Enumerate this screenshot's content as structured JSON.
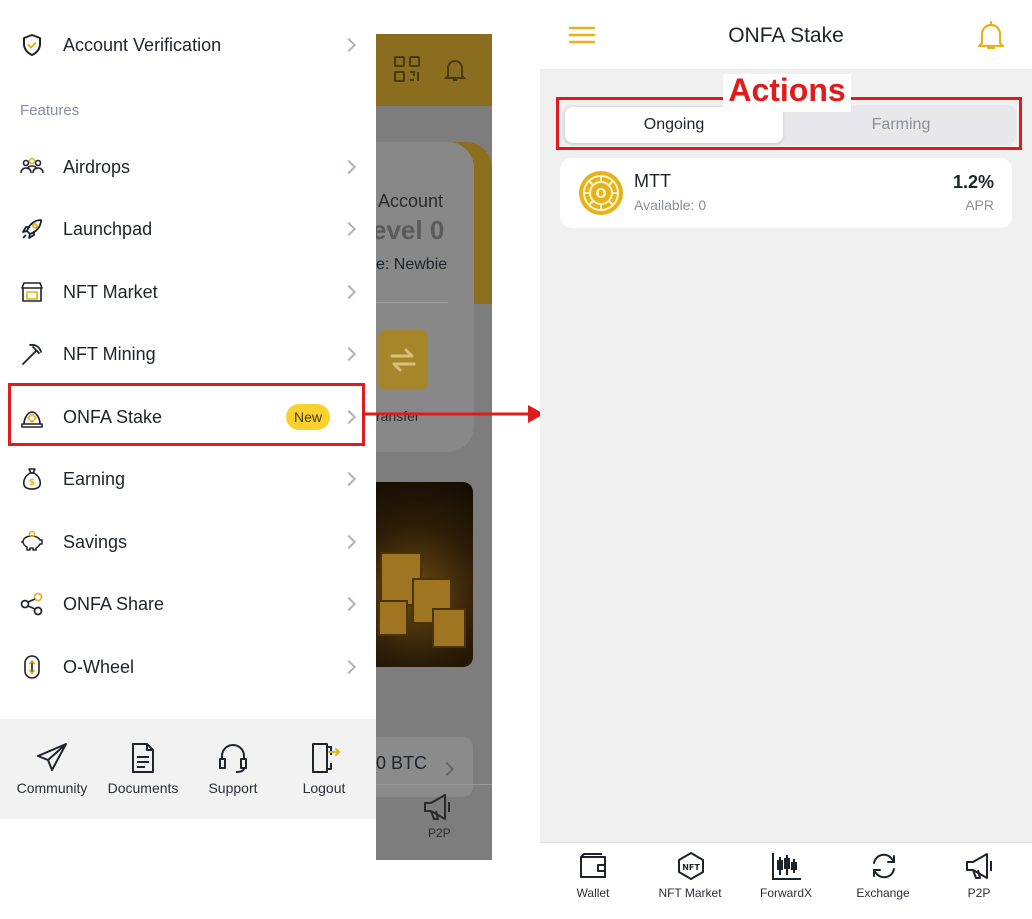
{
  "drawer": {
    "account_verification": "Account Verification",
    "features_label": "Features",
    "items": [
      {
        "label": "Airdrops",
        "icon": "airdrops-icon"
      },
      {
        "label": "Launchpad",
        "icon": "rocket-icon"
      },
      {
        "label": "NFT Market",
        "icon": "nft-market-icon"
      },
      {
        "label": "NFT Mining",
        "icon": "pickaxe-icon"
      },
      {
        "label": "ONFA Stake",
        "icon": "stake-icon",
        "badge": "New"
      },
      {
        "label": "Earning",
        "icon": "money-bag-icon"
      },
      {
        "label": "Savings",
        "icon": "piggy-bank-icon"
      },
      {
        "label": "ONFA Share",
        "icon": "share-icon"
      },
      {
        "label": "O-Wheel",
        "icon": "wheel-icon"
      }
    ],
    "footer": [
      {
        "label": "Community",
        "icon": "paper-plane-icon"
      },
      {
        "label": "Documents",
        "icon": "document-icon"
      },
      {
        "label": "Support",
        "icon": "headset-icon"
      },
      {
        "label": "Logout",
        "icon": "logout-icon"
      }
    ]
  },
  "background_app": {
    "account": "Account",
    "level": "evel 0",
    "rank": "e: Newbie",
    "transfer": "ransfer",
    "btc": "0 BTC",
    "p2p": "P2P"
  },
  "annotation": {
    "actions": "Actions",
    "highlight_color": "#e01b1b"
  },
  "stake_screen": {
    "title": "ONFA Stake",
    "tabs": [
      {
        "label": "Ongoing",
        "active": true
      },
      {
        "label": "Farming",
        "active": false
      }
    ],
    "pool": {
      "token": "MTT",
      "available": "Available: 0",
      "apr_value": "1.2%",
      "apr_label": "APR"
    },
    "nav": [
      {
        "label": "Wallet",
        "icon": "wallet-icon"
      },
      {
        "label": "NFT Market",
        "icon": "nft-icon"
      },
      {
        "label": "ForwardX",
        "icon": "candlestick-icon"
      },
      {
        "label": "Exchange",
        "icon": "exchange-icon"
      },
      {
        "label": "P2P",
        "icon": "megaphone-icon"
      }
    ]
  },
  "colors": {
    "brand_gold": "#e6b21c",
    "badge_yellow": "#f8d12f",
    "annotation_red": "#e01b1b"
  }
}
